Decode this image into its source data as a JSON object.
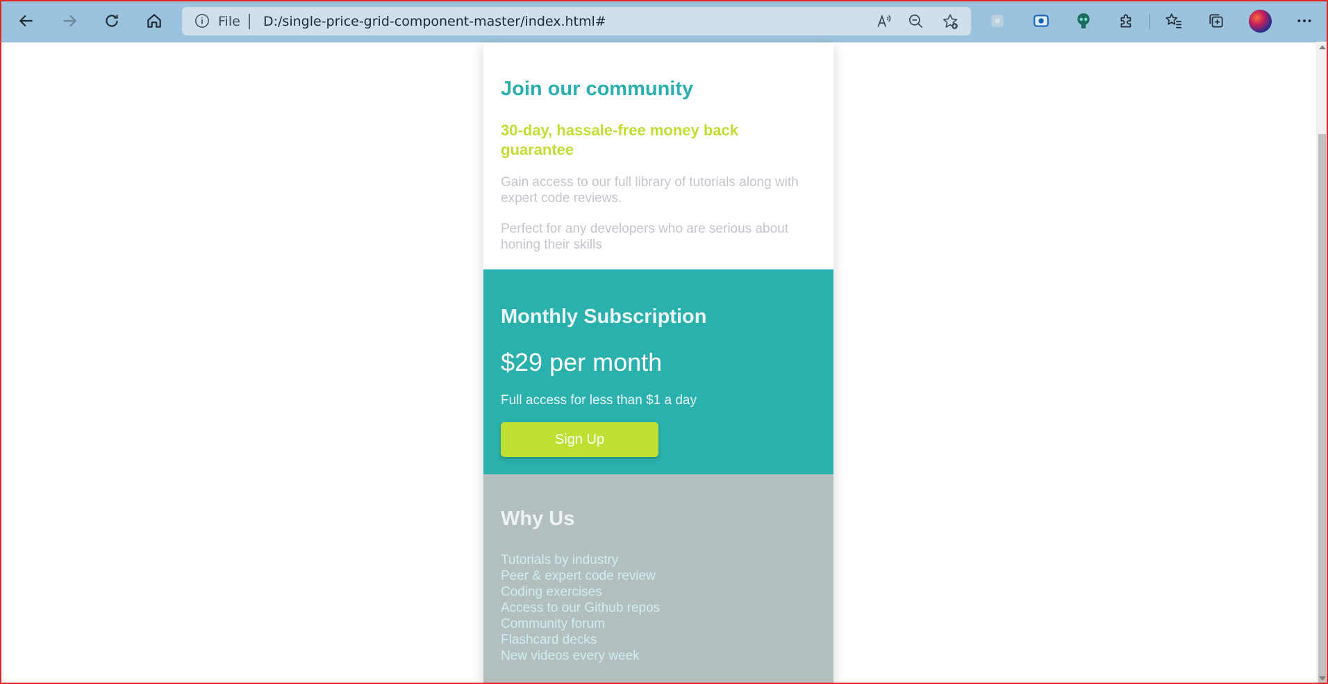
{
  "browser": {
    "address_file_label": "File",
    "url": "D:/single-price-grid-component-master/index.html#",
    "icons": [
      "back-icon",
      "forward-icon",
      "refresh-icon",
      "home-icon",
      "info-icon",
      "read-aloud-icon",
      "zoom-out-icon",
      "add-favorite-icon",
      "extension-icon",
      "screen-capture-icon",
      "browser-essentials-icon",
      "puzzle-icon",
      "favorites-icon",
      "collections-icon",
      "profile-avatar",
      "more-icon"
    ]
  },
  "community": {
    "title": "Join our community",
    "guarantee": "30-day, hassale-free money back guarantee",
    "description_1": "Gain access to our full library of tutorials along with expert code reviews.",
    "description_2": "Perfect for any developers who are serious about honing their skills"
  },
  "subscription": {
    "title": "Monthly Subscription",
    "price": "$29 per month",
    "access_note": "Full access for less than $1 a day",
    "signup_label": "Sign Up"
  },
  "why_us": {
    "title": "Why Us",
    "items": [
      "Tutorials by industry",
      "Peer & expert code review",
      "Coding exercises",
      "Access to our Github repos",
      "Community forum",
      "Flashcard decks",
      "New videos every week"
    ]
  },
  "colors": {
    "toolbar": "#9cc3dd",
    "teal": "#2ab0ad",
    "lime": "#bfdf33",
    "gray_panel": "#b3bfbf",
    "muted_text": "#c2c6cc"
  }
}
